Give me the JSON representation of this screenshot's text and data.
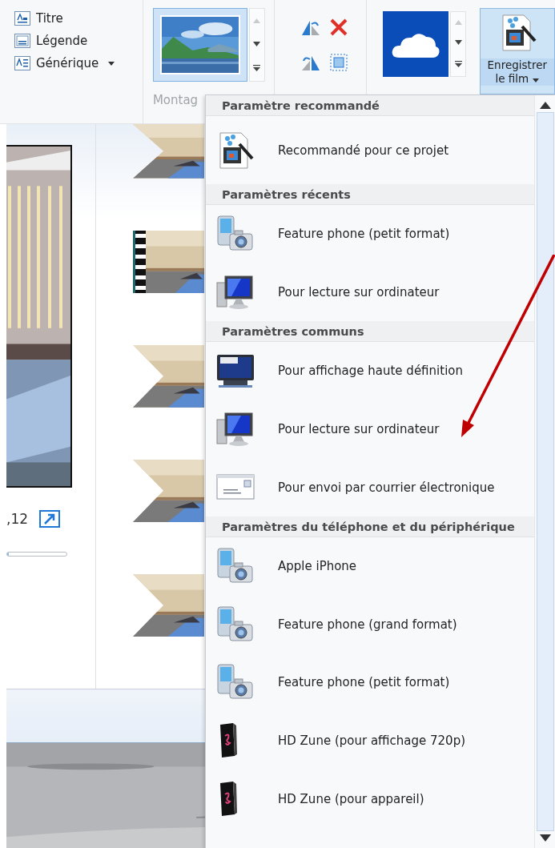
{
  "ribbon": {
    "text_buttons": [
      {
        "label": "Titre",
        "kind": "title",
        "dropdown": false
      },
      {
        "label": "Légende",
        "kind": "caption",
        "dropdown": false
      },
      {
        "label": "Générique",
        "kind": "credits",
        "dropdown": true
      }
    ],
    "theme_group_label": "Montag",
    "save_button": {
      "line_1": "Enregistrer",
      "line_2": "le film",
      "dropdown": true,
      "selected": true
    }
  },
  "preview": {
    "time": ",12",
    "seek": {
      "level": 0
    }
  },
  "storyboard": {
    "clips": [
      {
        "kind": "transition"
      },
      {
        "kind": "film"
      },
      {
        "kind": "transition"
      },
      {
        "kind": "transition"
      },
      {
        "kind": "transition"
      }
    ]
  },
  "menu": {
    "sections": [
      {
        "title": "Paramètre recommandé",
        "items": [
          {
            "label": "Recommandé pour ce projet",
            "kind": "project"
          }
        ]
      },
      {
        "title": "Paramètres récents",
        "items": [
          {
            "label": "Feature phone (petit format)",
            "kind": "phone"
          },
          {
            "label": "Pour lecture sur ordinateur",
            "kind": "computer"
          }
        ]
      },
      {
        "title": "Paramètres communs",
        "items": [
          {
            "label": "Pour affichage haute définition",
            "kind": "hdtv"
          },
          {
            "label": "Pour lecture sur ordinateur",
            "kind": "computer"
          },
          {
            "label": "Pour envoi par courrier électronique",
            "kind": "email"
          }
        ]
      },
      {
        "title": "Paramètres du téléphone et du périphérique",
        "items": [
          {
            "label": "Apple iPhone",
            "kind": "phone"
          },
          {
            "label": "Feature phone (grand format)",
            "kind": "phone"
          },
          {
            "label": "Feature phone (petit format)",
            "kind": "phone"
          },
          {
            "label": "HD Zune (pour affichage 720p)",
            "kind": "zune"
          },
          {
            "label": "HD Zune (pour appareil)",
            "kind": "zune"
          }
        ]
      }
    ]
  }
}
